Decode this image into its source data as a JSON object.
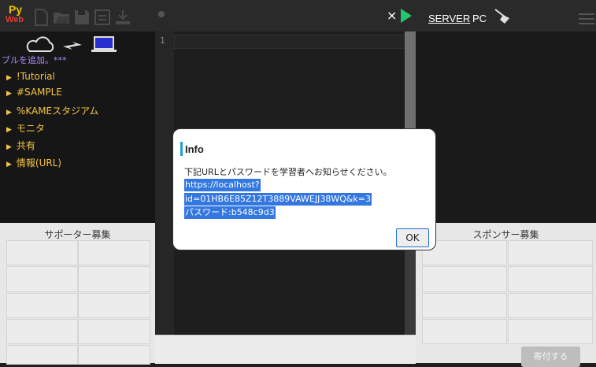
{
  "app": {
    "logo_text_py": "Py",
    "logo_text_web": "Web"
  },
  "toolbar": {
    "icons": [
      "new-file-icon",
      "open-folder-icon",
      "save-icon",
      "save-as-icon",
      "download-icon"
    ],
    "close_label": "×",
    "server_label": "SERVER",
    "pc_label": "PC"
  },
  "left_panel": {
    "add_note": "ブルを追加。***",
    "tree_items": [
      "!Tutorial",
      "#SAMPLE",
      "%KAMEスタジアム",
      "モニタ",
      "共有",
      "情報(URL)"
    ]
  },
  "editor": {
    "line_number": "1"
  },
  "supporters": {
    "title": "サポーター募集"
  },
  "sponsors": {
    "title": "スポンサー募集",
    "donate_label": "寄付する"
  },
  "dialog": {
    "title": "Info",
    "message": "下記URLとパスワードを学習者へお知らせください。",
    "url_line1": "https://localhost?",
    "url_line2": "id=01HB6E85Z12T3889VAWEJJ38WQ&k=3",
    "password_line": "パスワード:b548c9d3",
    "ok_label": "OK"
  },
  "colors": {
    "accent_green": "#21c76a",
    "tree_text": "#f5c542",
    "selection": "#3377e0",
    "info_bar": "#1ea0d7"
  }
}
